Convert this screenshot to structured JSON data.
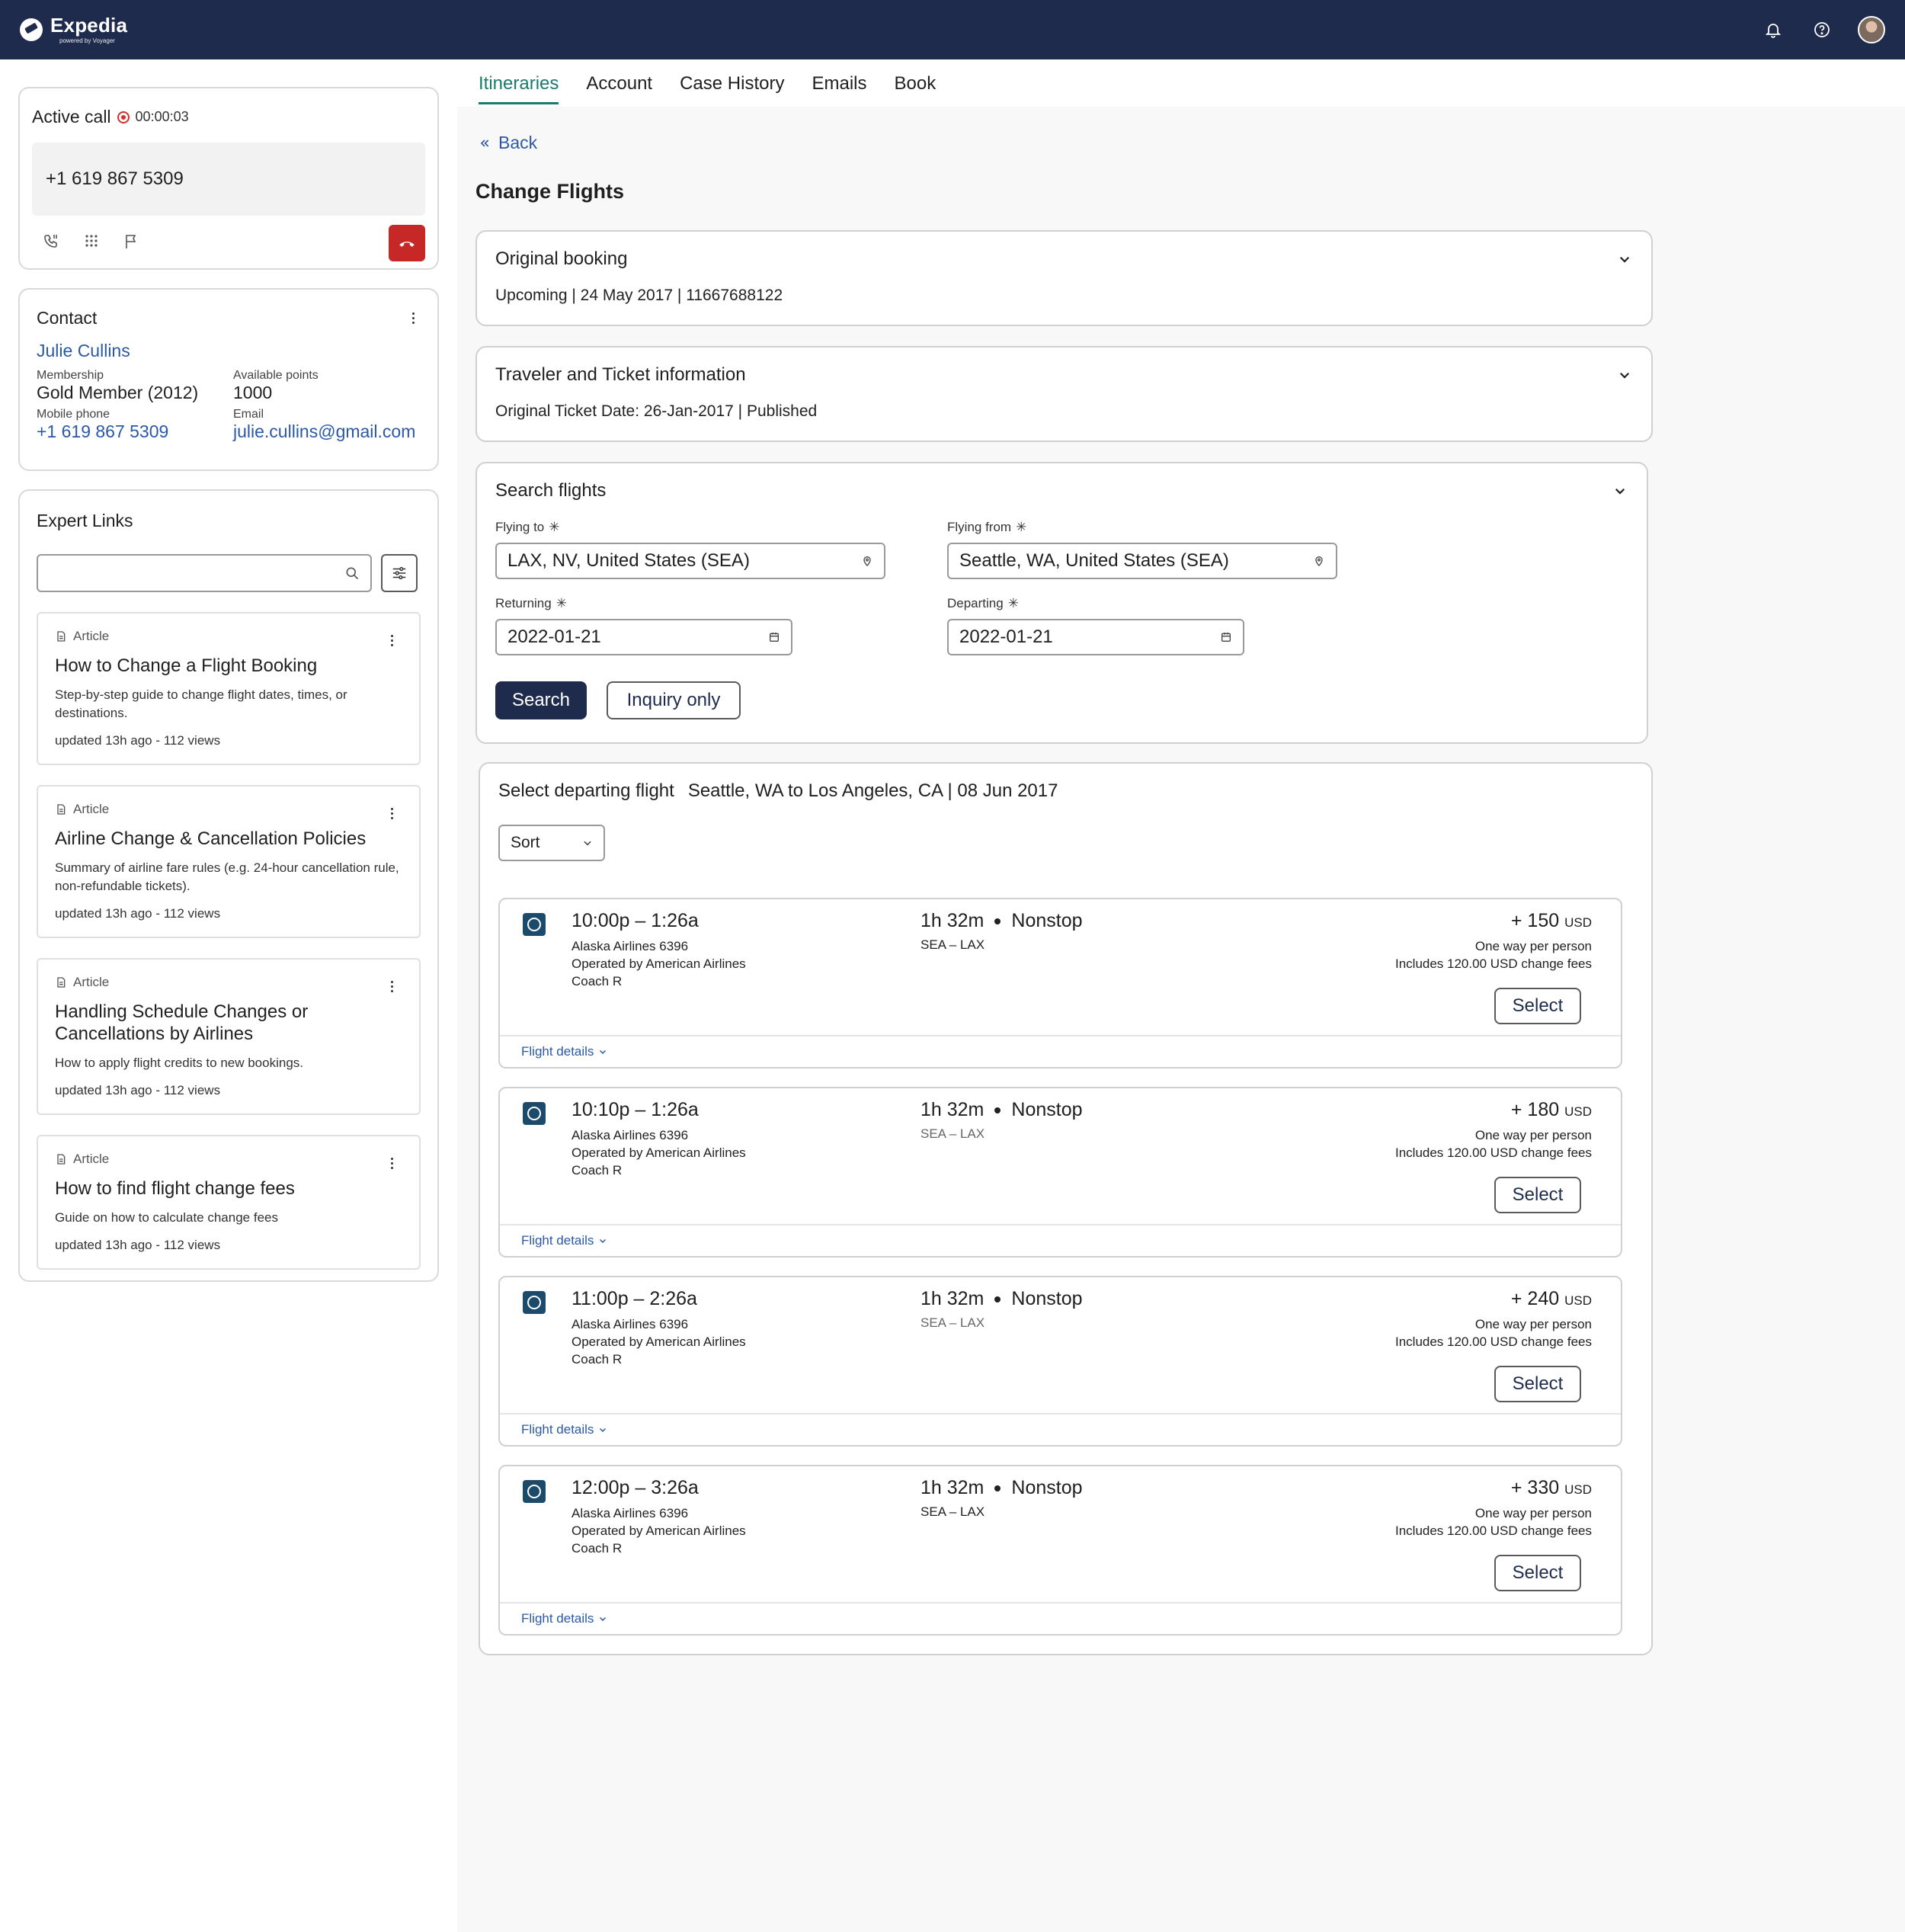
{
  "header": {
    "brand_name": "Expedia",
    "brand_sub": "powered by Voyager",
    "icons": [
      "bell-icon",
      "help-icon",
      "user-avatar"
    ],
    "color": "#1f2b4d"
  },
  "call": {
    "title": "Active call",
    "timer": "00:00:03",
    "phone": "+1 619 867 5309",
    "tools": [
      "call-transfer-icon",
      "dialpad-icon",
      "flag-icon"
    ],
    "hangup_icon": "phone-hangup-icon",
    "hangup_color": "#c62828"
  },
  "contact": {
    "title": "Contact",
    "name": "Julie Cullins",
    "membership_label": "Membership",
    "membership_value": "Gold Member (2012)",
    "points_label": "Available points",
    "points_value": "1000",
    "phone_label": "Mobile phone",
    "phone_value": "+1 619 867 5309",
    "email_label": "Email",
    "email_value": "julie.cullins@gmail.com"
  },
  "expert_links": {
    "title": "Expert Links",
    "search_value": "",
    "articles": [
      {
        "tag": "Article",
        "title": "How to Change a Flight Booking",
        "desc": "Step-by-step guide to change flight dates, times, or destinations.",
        "meta": "updated 13h ago - 112 views"
      },
      {
        "tag": "Article",
        "title": "Airline Change & Cancellation Policies",
        "desc": "Summary of airline fare rules (e.g. 24-hour cancellation rule, non-refundable tickets).",
        "meta": "updated 13h ago - 112 views"
      },
      {
        "tag": "Article",
        "title": "Handling Schedule Changes or Cancellations by Airlines",
        "desc": "How to apply flight credits to new bookings.",
        "meta": "updated 13h ago - 112 views"
      },
      {
        "tag": "Article",
        "title": "How to find flight change fees",
        "desc": "Guide on how to calculate change fees",
        "meta": "updated 13h ago - 112 views"
      }
    ]
  },
  "tabs": [
    "Itineraries",
    "Account",
    "Case History",
    "Emails",
    "Book"
  ],
  "active_tab": "Itineraries",
  "accent": "#1a7a6e",
  "link_color": "#2b59a8",
  "back_label": "Back",
  "page_title": "Change Flights",
  "original_booking": {
    "title": "Original booking",
    "sub": "Upcoming | 24 May 2017 | 11667688122"
  },
  "traveler_info": {
    "title": "Traveler and Ticket information",
    "sub": "Original Ticket Date: 26-Jan-2017 | Published"
  },
  "search": {
    "title": "Search flights",
    "flying_to_label": "Flying to",
    "flying_to_value": "LAX, NV, United States (SEA)",
    "flying_from_label": "Flying from",
    "flying_from_value": "Seattle, WA, United States (SEA)",
    "returning_label": "Returning",
    "returning_value": "2022-01-21",
    "departing_label": "Departing",
    "departing_value": "2022-01-21",
    "search_btn": "Search",
    "inquiry_btn": "Inquiry only"
  },
  "results": {
    "title": "Select departing flight",
    "route": "Seattle, WA to Los Angeles, CA | 08 Jun 2017",
    "sort_label": "Sort",
    "flights": [
      {
        "times": "10:00p – 1:26a",
        "airline": "Alaska Airlines 6396",
        "operated": "Operated by American Airlines",
        "cabin": "Coach R",
        "duration": "1h 32m",
        "stops": "Nonstop",
        "route": "SEA – LAX",
        "price": "+ 150",
        "currency": "USD",
        "price_note": "One way per person",
        "fees": "Includes 120.00 USD change fees",
        "select": "Select",
        "details": "Flight details"
      },
      {
        "times": "10:10p – 1:26a",
        "airline": "Alaska Airlines 6396",
        "operated": "Operated by American Airlines",
        "cabin": "Coach R",
        "duration": "1h 32m",
        "stops": "Nonstop",
        "route": "SEA – LAX",
        "price": "+ 180",
        "currency": "USD",
        "price_note": "One way per person",
        "fees": "Includes 120.00 USD change fees",
        "select": "Select",
        "details": "Flight details"
      },
      {
        "times": "11:00p – 2:26a",
        "airline": "Alaska Airlines 6396",
        "operated": "Operated by American Airlines",
        "cabin": "Coach R",
        "duration": "1h 32m",
        "stops": "Nonstop",
        "route": "SEA – LAX",
        "price": "+ 240",
        "currency": "USD",
        "price_note": "One way per person",
        "fees": "Includes 120.00 USD change fees",
        "select": "Select",
        "details": "Flight details"
      },
      {
        "times": "12:00p – 3:26a",
        "airline": "Alaska Airlines 6396",
        "operated": "Operated by American Airlines",
        "cabin": "Coach R",
        "duration": "1h 32m",
        "stops": "Nonstop",
        "route": "SEA – LAX",
        "price": "+ 330",
        "currency": "USD",
        "price_note": "One way per person",
        "fees": "Includes 120.00 USD change fees",
        "select": "Select",
        "details": "Flight details"
      }
    ]
  }
}
